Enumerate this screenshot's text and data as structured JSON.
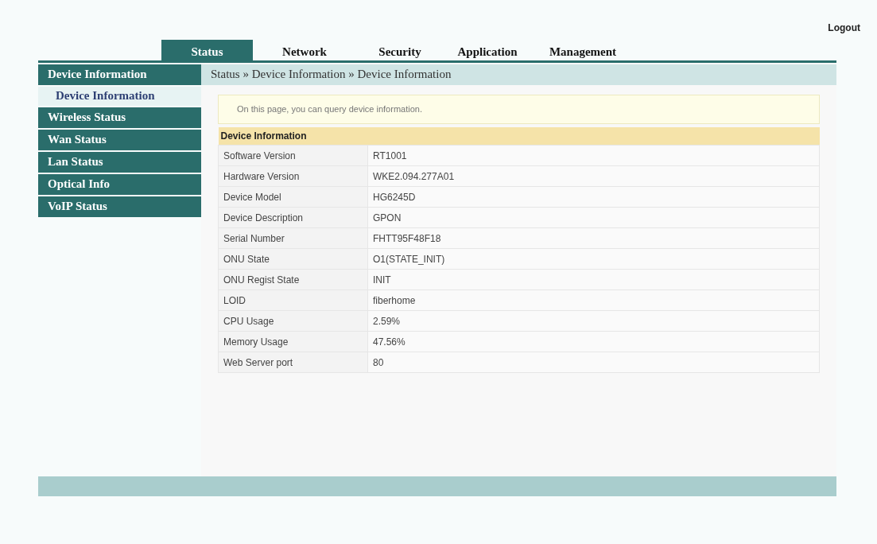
{
  "logout": "Logout",
  "tabs": [
    {
      "label": "Status",
      "selected": true
    },
    {
      "label": "Network",
      "selected": false
    },
    {
      "label": "Security",
      "selected": false
    },
    {
      "label": "Application",
      "selected": false
    },
    {
      "label": "Management",
      "selected": false
    }
  ],
  "sidebar": {
    "items": [
      {
        "label": "Device Information",
        "children": [
          {
            "label": "Device Information",
            "selected": true
          }
        ]
      },
      {
        "label": "Wireless Status"
      },
      {
        "label": "Wan Status"
      },
      {
        "label": "Lan Status"
      },
      {
        "label": "Optical Info"
      },
      {
        "label": "VoIP Status"
      }
    ]
  },
  "breadcrumb": "Status » Device Information » Device Information",
  "notice": "On this page, you can query device information.",
  "table": {
    "title": "Device Information",
    "rows": [
      {
        "label": "Software Version",
        "value": "RT1001"
      },
      {
        "label": "Hardware Version",
        "value": "WKE2.094.277A01"
      },
      {
        "label": "Device Model",
        "value": "HG6245D"
      },
      {
        "label": "Device Description",
        "value": "GPON"
      },
      {
        "label": "Serial Number",
        "value": "FHTT95F48F18"
      },
      {
        "label": "ONU State",
        "value": "O1(STATE_INIT)"
      },
      {
        "label": "ONU Regist State",
        "value": "INIT"
      },
      {
        "label": "LOID",
        "value": "fiberhome"
      },
      {
        "label": "CPU Usage",
        "value": "2.59%"
      },
      {
        "label": "Memory Usage",
        "value": "47.56%"
      },
      {
        "label": "Web Server port",
        "value": "80"
      }
    ]
  }
}
